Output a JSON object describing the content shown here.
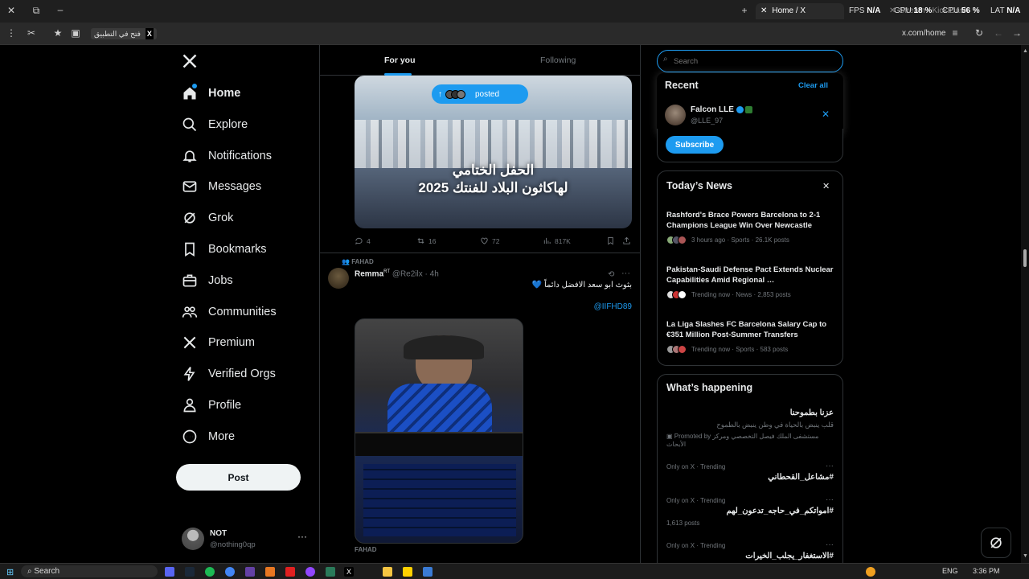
{
  "browser": {
    "tabs": [
      {
        "label": "Stream - Kick Dashboard"
      },
      {
        "label": "Home / X"
      }
    ],
    "stats": {
      "fps_label": "FPS",
      "fps_value": "N/A",
      "gpu_label": "GPU",
      "gpu_value": "18 %",
      "cpu_label": "CPU",
      "cpu_value": "56 %",
      "lat_label": "LAT",
      "lat_value": "N/A"
    },
    "open_in_app": "فتح في التطبيق",
    "url": "x.com/home"
  },
  "nav": {
    "items": [
      {
        "label": "Home",
        "icon": "home-icon"
      },
      {
        "label": "Explore",
        "icon": "search-icon"
      },
      {
        "label": "Notifications",
        "icon": "bell-icon"
      },
      {
        "label": "Messages",
        "icon": "mail-icon"
      },
      {
        "label": "Grok",
        "icon": "grok-icon"
      },
      {
        "label": "Bookmarks",
        "icon": "bookmark-icon"
      },
      {
        "label": "Jobs",
        "icon": "briefcase-icon"
      },
      {
        "label": "Communities",
        "icon": "people-icon"
      },
      {
        "label": "Premium",
        "icon": "x-logo-icon"
      },
      {
        "label": "Verified Orgs",
        "icon": "lightning-icon"
      },
      {
        "label": "Profile",
        "icon": "person-icon"
      },
      {
        "label": "More",
        "icon": "more-circle-icon"
      }
    ],
    "post_label": "Post",
    "account": {
      "name": "NOT",
      "handle": "@nothing0qp"
    }
  },
  "feed": {
    "tabs": [
      {
        "label": "For you"
      },
      {
        "label": "Following"
      }
    ],
    "posted_pill": "posted",
    "post1": {
      "image_text_line1": "الحفل الختامي",
      "image_text_line2": "لهاكاثون البلاد للفنتك 2025",
      "replies": "4",
      "reposts": "16",
      "likes": "72",
      "views": "817K"
    },
    "post2": {
      "context": "FAHAD",
      "name": "Remma",
      "badge": "RT",
      "handle": "@Re2ilx",
      "time": "· 4h",
      "text": "بثوث ابو سعد الافضل دائماً 💙",
      "mention": "@IIFHD89",
      "footer_context": "FAHAD"
    }
  },
  "search": {
    "placeholder": "Search"
  },
  "recent": {
    "title": "Recent",
    "clear_label": "Clear all",
    "items": [
      {
        "name": "Falcon LLE",
        "handle": "@LLE_97"
      }
    ]
  },
  "subscribe_label": "Subscribe",
  "todays_news": {
    "title": "Today’s News",
    "items": [
      {
        "title": "Rashford's Brace Powers Barcelona to 2-1 Champions League Win Over Newcastle",
        "meta": "3 hours ago · Sports · 26.1K posts"
      },
      {
        "title": "Pakistan-Saudi Defense Pact Extends Nuclear Capabilities Amid Regional …",
        "meta": "Trending now · News · 2,853 posts"
      },
      {
        "title": "La Liga Slashes FC Barcelona Salary Cap to €351 Million Post-Summer Transfers",
        "meta": "Trending now · Sports · 583 posts"
      }
    ]
  },
  "whats_happening": {
    "title": "What’s happening",
    "promo": {
      "title": "عزنا بطموحنا",
      "text": "قلب ينبض بالحياة في وطن ينبض بالطموح",
      "by": "Promoted by مستشفى الملك فيصل التخصصي ومركز الأبحاث"
    },
    "trends": [
      {
        "meta": "Only on X · Trending",
        "tag": "#مشاعل_القحطاني",
        "count": ""
      },
      {
        "meta": "Only on X · Trending",
        "tag": "#امواتكم_في_حاجه_تدعون_لهم",
        "count": "1,613 posts"
      },
      {
        "meta": "Only on X · Trending",
        "tag": "#الاستغفار_يجلب_الخيرات",
        "count": ""
      }
    ]
  },
  "taskbar": {
    "search_label": "Search",
    "lang": "ENG",
    "time": "3:36 PM"
  },
  "colors": {
    "accent": "#1d9bf0",
    "bg": "#000000",
    "border": "#2f3336",
    "muted": "#71767b"
  }
}
